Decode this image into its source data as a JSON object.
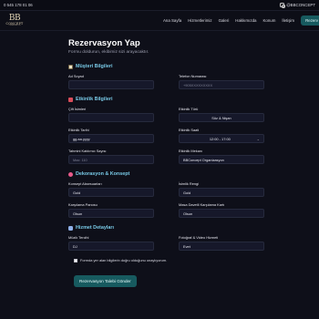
{
  "topbar": {
    "phone": "0 545 178 01 06",
    "instagram": "@BBCONCEPT",
    "instagram_icon": "instagram-icon"
  },
  "logo": {
    "mark": "BB",
    "word": "CONCEPT",
    "tag": "ORGANIZASYON"
  },
  "nav": {
    "items": [
      "Ana Sayfa",
      "Hizmetlerimiz",
      "Galeri",
      "Hakkımızda",
      "Konum",
      "İletişim"
    ],
    "cta": "Rezerv"
  },
  "page": {
    "title": "Rezervasyon Yap",
    "subtitle": "Formu doldurun, ekibimiz sizi arayacaktır."
  },
  "sections": {
    "customer": {
      "title": "Müşteri Bilgileri",
      "icon": "clipboard-icon",
      "icon_color": "#e9e2c8",
      "name_label": "Ad Soyad",
      "name_value": "",
      "phone_label": "Telefon Numarası",
      "phone_placeholder": "+905XXXXXXXXX"
    },
    "event": {
      "title": "Etkinlik Bilgileri",
      "icon": "calendar-icon",
      "icon_color": "#d94d5a",
      "couple_label": "Çift İsimleri",
      "couple_value": "",
      "type_label": "Etkinlik Türü",
      "type_value": "Söz & Nişan",
      "date_label": "Etkinlik Tarihi",
      "date_placeholder": "gg.aa.yyyy",
      "time_label": "Etkinlik Saati",
      "time_value": "12:00 - 17:00",
      "guests_label": "Tahmini Katılımcı Sayısı",
      "guests_placeholder": "Max: 110",
      "venue_label": "Etkinlik Mekanı",
      "venue_value": "BBConcept Organizasyon"
    },
    "decor": {
      "title": "Dekorasyon & Konsept",
      "icon": "ribbon-icon",
      "icon_color": "#e85a8a",
      "acc_label": "Konsept Aksesuarları",
      "acc_value": "Gold",
      "name_color_label": "İsimlik Rengi",
      "name_color_value": "Gold",
      "board_label": "Karşılama Panosu",
      "board_value": "Olsun",
      "table_card_label": "Masa Davetli Karşılama Kartı",
      "table_card_value": "Olsun"
    },
    "service": {
      "title": "Hizmet Detayları",
      "icon": "speech-bubble-icon",
      "icon_color": "#8fb0e8",
      "music_label": "Müzik Tercihi",
      "music_value": "DJ",
      "photo_label": "Fotoğraf & Video Hizmeti",
      "photo_value": "Evet"
    }
  },
  "consent": "Formda yer alan bilgilerin doğru olduğunu onaylıyorum.",
  "submit": "Rezervasyon Talebi Gönder"
}
